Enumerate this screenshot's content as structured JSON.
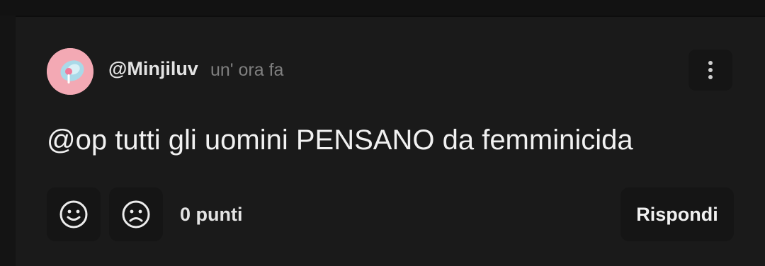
{
  "comment": {
    "username": "@Minjiluv",
    "timestamp": "un' ora fa",
    "text": "@op tutti gli uomini PENSANO da femminicida",
    "points": "0 punti"
  },
  "actions": {
    "reply_label": "Rispondi",
    "upvote_icon": "smile-icon",
    "downvote_icon": "frown-icon",
    "more_icon": "vertical-dots-icon"
  },
  "colors": {
    "background": "#1a1a1a",
    "avatar": "#f3a9b4",
    "text": "#f1f1f1",
    "muted": "#7f7f7f"
  }
}
